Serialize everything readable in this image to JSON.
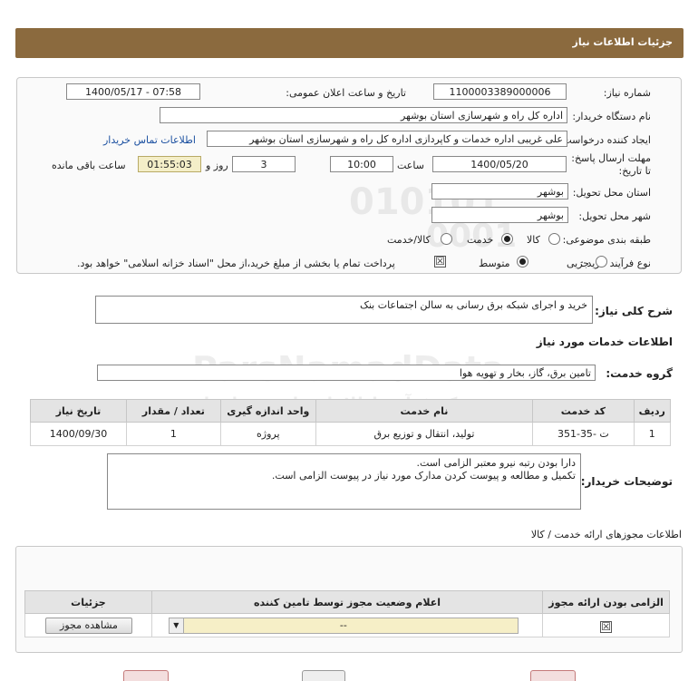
{
  "header": {
    "title": "جزئیات اطلاعات نیاز"
  },
  "watermark": {
    "digits1": "010101",
    "digits2": "0001",
    "brand": "ParsNamadData",
    "arabic1": "مرکز فرآیند اطلاعات پارس نماد داده",
    "arabic2": "پایگاه اطلاع رسانی مناقصه و مزایده",
    "phone": "۰۲۱- ۸۸۳۴۹۶۷۰"
  },
  "form": {
    "need_number_label": "شماره نیاز:",
    "need_number": "1100003389000006",
    "announce_label": "تاریخ و ساعت اعلان عمومی:",
    "announce_value": "1400/05/17 - 07:58",
    "buyer_org_label": "نام دستگاه خریدار:",
    "buyer_org": "اداره کل راه و شهرسازی استان بوشهر",
    "creator_label": "ایجاد کننده درخواست:",
    "creator": "علی غریبی اداره خدمات و کاپردازی اداره کل راه و شهرسازی استان بوشهر",
    "contact_link": "اطلاعات تماس خریدار",
    "deadline_label": "مهلت ارسال پاسخ: تا تاریخ:",
    "deadline_date": "1400/05/20",
    "time_label": "ساعت",
    "deadline_time": "10:00",
    "days_value": "3",
    "days_label": "روز و",
    "remaining_time": "01:55:03",
    "remaining_label": "ساعت باقی مانده",
    "province_label": "استان محل تحویل:",
    "province": "بوشهر",
    "city_label": "شهر محل تحویل:",
    "city": "بوشهر",
    "category_label": "طبقه بندی موضوعی:",
    "category_options": [
      "کالا",
      "خدمت",
      "کالا/خدمت"
    ],
    "category_selected": "خدمت",
    "process_label": "نوع فرآیند خرید :",
    "process_options": [
      "جزیی",
      "متوسط"
    ],
    "process_selected": "متوسط",
    "payment_note": "پرداخت تمام یا بخشی از مبلغ خرید،از محل \"اسناد خزانه اسلامی\" خواهد بود."
  },
  "summary": {
    "label": "شرح کلی نیاز:",
    "value": "خرید و  اجرای شبکه برق رسانی به سالن اجتماعات بنک"
  },
  "services": {
    "title": "اطلاعات خدمات مورد نیاز",
    "group_label": "گروه خدمت:",
    "group_value": "تامین برق، گاز، بخار و تهویه هوا",
    "table": {
      "headers": [
        "ردیف",
        "کد خدمت",
        "نام خدمت",
        "واحد اندازه گیری",
        "تعداد / مقدار",
        "تاریخ نیاز"
      ],
      "rows": [
        [
          "1",
          "ت -35-351",
          "تولید، انتقال و توزیع برق",
          "پروژه",
          "1",
          "1400/09/30"
        ]
      ]
    }
  },
  "buyer_notes": {
    "label": "توضیحات خریدار:",
    "line1": "دارا بودن رتبه نیرو معتبر الزامی است.",
    "line2": "تکمیل و مطالعه و پیوست کردن مدارک مورد نیاز در پیوست الزامی است."
  },
  "permits": {
    "title": "اطلاعات مجوزهای ارائه خدمت / کالا",
    "headers": [
      "الزامی بودن ارائه مجوز",
      "اعلام وضعیت مجوز توسط تامین کننده",
      "جزئیات"
    ],
    "status_value": "--",
    "view_button": "مشاهده مجوز"
  }
}
